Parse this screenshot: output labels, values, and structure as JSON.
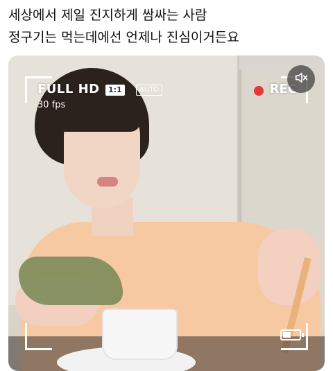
{
  "post": {
    "lines": [
      "세상에서 제일 진지하게 쌈싸는 사람",
      "정구기는 먹는데에선 언제나 진심이거든요"
    ]
  },
  "video": {
    "resolution": "FULL HD",
    "fps": "30 fps",
    "aspect_ratio": "1:1",
    "mode": "AUTO",
    "rec_label": "REC",
    "rec_color": "#e23a3a",
    "mute_icon": "speaker-mute-icon",
    "battery_level": 0.5
  }
}
